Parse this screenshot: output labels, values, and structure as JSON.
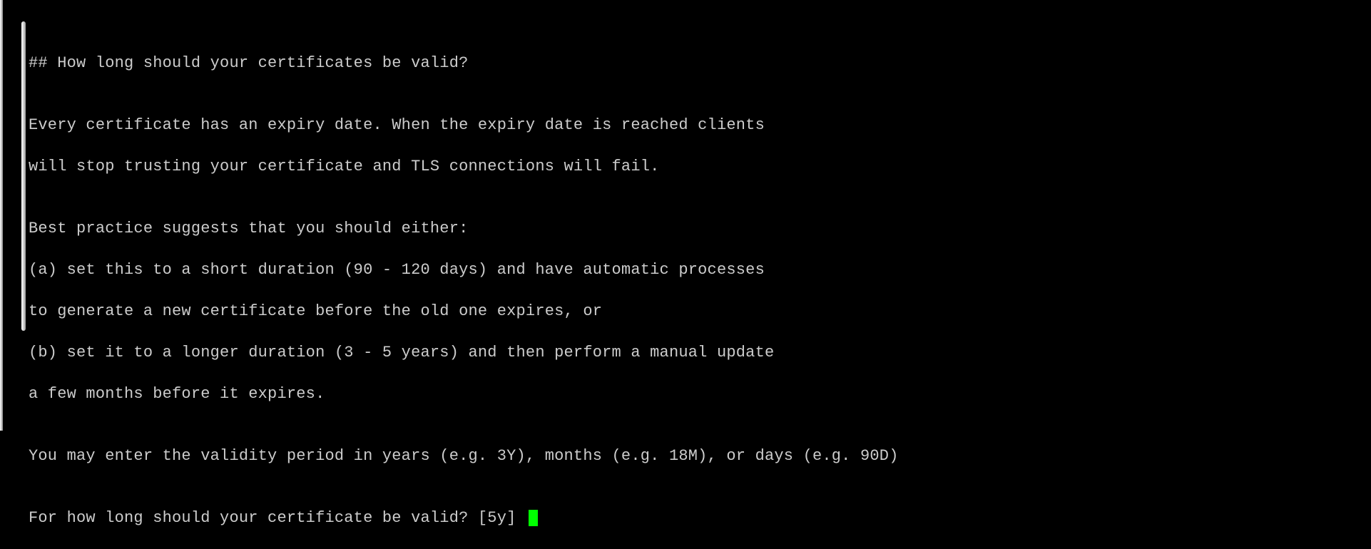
{
  "terminal": {
    "heading": "## How long should your certificates be valid?",
    "blank1": "",
    "para1_line1": "Every certificate has an expiry date. When the expiry date is reached clients",
    "para1_line2": "will stop trusting your certificate and TLS connections will fail.",
    "blank2": "",
    "para2_intro": "Best practice suggests that you should either:",
    "para2_a1": "(a) set this to a short duration (90 - 120 days) and have automatic processes",
    "para2_a2": "to generate a new certificate before the old one expires, or",
    "para2_b1": "(b) set it to a longer duration (3 - 5 years) and then perform a manual update",
    "para2_b2": "a few months before it expires.",
    "blank3": "",
    "para3": "You may enter the validity period in years (e.g. 3Y), months (e.g. 18M), or days (e.g. 90D)",
    "blank4": "",
    "prompt_text": "For how long should your certificate be valid? [5y] ",
    "prompt_default": "5y",
    "input_value": ""
  }
}
